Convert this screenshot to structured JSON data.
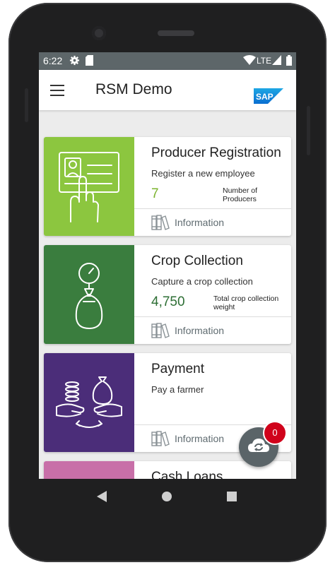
{
  "status_bar": {
    "time": "6:22",
    "network": "LTE"
  },
  "app_bar": {
    "title": "RSM Demo",
    "logo_text": "SAP"
  },
  "cards": [
    {
      "title": "Producer Registration",
      "subtitle": "Register a new employee",
      "metric_value": "7",
      "metric_label_line1": "Number of",
      "metric_label_line2": "Producers",
      "info_label": "Information",
      "tile_color": "#8cc63f",
      "metric_color": "#7bb32e"
    },
    {
      "title": "Crop Collection",
      "subtitle": "Capture a crop collection",
      "metric_value": "4,750",
      "metric_label_line1": "Total crop collection",
      "metric_label_line2": "weight",
      "info_label": "Information",
      "tile_color": "#3a7d3e",
      "metric_color": "#2e6f35"
    },
    {
      "title": "Payment",
      "subtitle": "Pay a farmer",
      "info_label": "Information",
      "tile_color": "#4b2d79"
    },
    {
      "title": "Cash Loans",
      "tile_color": "#c86fa8"
    }
  ],
  "sync_fab": {
    "badge_count": "0"
  },
  "icons": [
    "menu-icon",
    "sap-logo",
    "id-card-hand-icon",
    "scale-bag-icon",
    "money-exchange-icon",
    "books-icon",
    "cloud-sync-icon",
    "back-icon",
    "home-icon",
    "recents-icon"
  ]
}
